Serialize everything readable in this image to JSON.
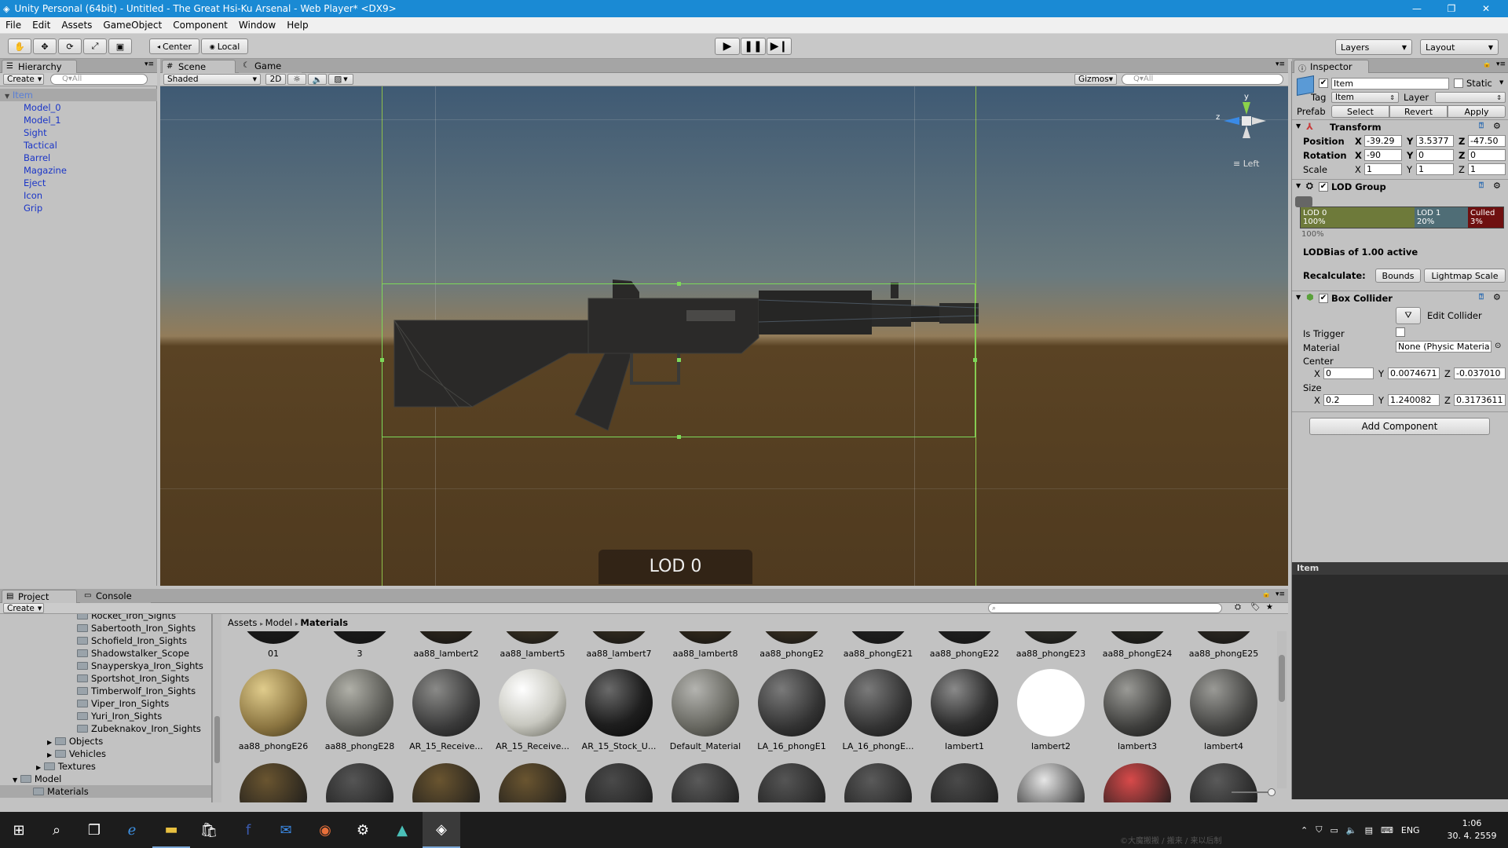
{
  "window": {
    "title": "Unity Personal (64bit) - Untitled - The Great Hsi-Ku Arsenal - Web Player* <DX9>",
    "minimize": "—",
    "maximize": "❐",
    "close": "✕"
  },
  "menu": [
    "File",
    "Edit",
    "Assets",
    "GameObject",
    "Component",
    "Window",
    "Help"
  ],
  "toolbar": {
    "pivot": "Center",
    "space": "Local",
    "layers": "Layers",
    "layout": "Layout"
  },
  "hierarchy": {
    "tab": "Hierarchy",
    "create": "Create",
    "search": "Q▾All",
    "root": "Item",
    "items": [
      "Model_0",
      "Model_1",
      "Sight",
      "Tactical",
      "Barrel",
      "Magazine",
      "Eject",
      "Icon",
      "Grip"
    ]
  },
  "scene": {
    "tab_scene": "Scene",
    "tab_game": "Game",
    "shading": "Shaded",
    "mode_2d": "2D",
    "gizmos": "Gizmos",
    "search": "Q▾All",
    "view_label": "≡ Left",
    "axis_y": "y",
    "axis_z": "z",
    "lod_label": "LOD 0"
  },
  "inspector": {
    "tab": "Inspector",
    "name": "Item",
    "static": "Static",
    "tag_label": "Tag",
    "tag": "Item",
    "layer_label": "Layer",
    "prefab": "Prefab",
    "select": "Select",
    "revert": "Revert",
    "apply": "Apply",
    "transform": {
      "title": "Transform",
      "position": "Position",
      "rotation": "Rotation",
      "scale": "Scale",
      "pos": [
        "-39.29",
        "3.5377",
        "-47.50"
      ],
      "rot": [
        "-90",
        "0",
        "0"
      ],
      "scl": [
        "1",
        "1",
        "1"
      ],
      "x": "X",
      "y": "Y",
      "z": "Z"
    },
    "lod": {
      "title": "LOD Group",
      "lod0": "LOD 0",
      "lod0p": "100%",
      "lod1": "LOD 1",
      "lod1p": "20%",
      "culled": "Culled",
      "culledp": "3%",
      "under": "100%",
      "bias": "LODBias of 1.00 active",
      "recalc": "Recalculate:",
      "bounds": "Bounds",
      "lightmap": "Lightmap Scale"
    },
    "collider": {
      "title": "Box Collider",
      "edit": "Edit Collider",
      "trigger": "Is Trigger",
      "material": "Material",
      "material_val": "None (Physic Materia",
      "center": "Center",
      "size": "Size",
      "cx": "0",
      "cy": "0.0074671",
      "cz": "-0.037010",
      "sx": "0.2",
      "sy": "1.240082",
      "sz": "0.3173611"
    },
    "add": "Add Component",
    "preview": "Item"
  },
  "project": {
    "tab": "Project",
    "console": "Console",
    "create": "Create",
    "breadcrumb": [
      "Assets",
      "Model",
      "Materials"
    ],
    "tree": [
      "Rocket_Iron_Sights",
      "Sabertooth_Iron_Sights",
      "Schofield_Iron_Sights",
      "Shadowstalker_Scope",
      "Snayperskya_Iron_Sights",
      "Sportshot_Iron_Sights",
      "Timberwolf_Iron_Sights",
      "Viper_Iron_Sights",
      "Yuri_Iron_Sights",
      "Zubeknakov_Iron_Sights"
    ],
    "tree2": [
      "Objects",
      "Vehicles",
      "Textures",
      "Model",
      "Materials"
    ],
    "row1": [
      "01",
      "3",
      "aa88_lambert2",
      "aa88_lambert5",
      "aa88_lambert7",
      "aa88_lambert8",
      "aa88_phongE2",
      "aa88_phongE21",
      "aa88_phongE22",
      "aa88_phongE23",
      "aa88_phongE24",
      "aa88_phongE25"
    ],
    "row2": [
      "aa88_phongE26",
      "aa88_phongE28",
      "AR_15_Receive...",
      "AR_15_Receive...",
      "AR_15_Stock_U...",
      "Default_Material",
      "LA_16_phongE1",
      "LA_16_phongE...",
      "lambert1",
      "lambert2",
      "lambert3",
      "lambert4"
    ]
  },
  "taskbar": {
    "lang": "ENG",
    "time": "1:06",
    "date": "30. 4. 2559",
    "watermark": "©大魔搬搬 / 搬来 / 来以后制"
  }
}
